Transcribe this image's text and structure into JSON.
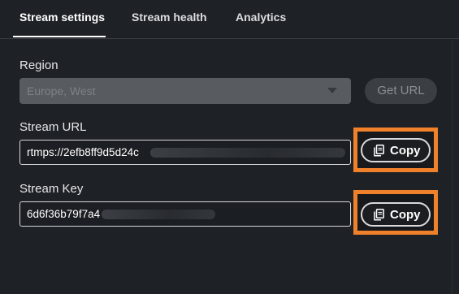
{
  "tabs": [
    {
      "label": "Stream settings",
      "active": true
    },
    {
      "label": "Stream health",
      "active": false
    },
    {
      "label": "Analytics",
      "active": false
    }
  ],
  "region": {
    "label": "Region",
    "value": "Europe, West",
    "get_url_label": "Get URL"
  },
  "stream_url": {
    "label": "Stream URL",
    "value": "rtmps://2efb8ff9d5d24c",
    "copy_label": "Copy"
  },
  "stream_key": {
    "label": "Stream Key",
    "value": "6d6f36b79f7a4",
    "copy_label": "Copy"
  },
  "colors": {
    "background": "#1e2126",
    "highlight": "#f0812a"
  },
  "icons": {
    "copy": "copy-icon",
    "dropdown": "chevron-down-icon"
  }
}
